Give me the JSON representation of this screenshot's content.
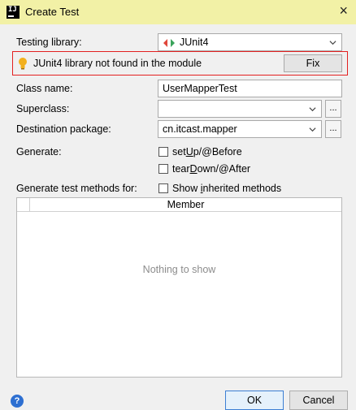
{
  "window": {
    "title": "Create Test",
    "close_glyph": "×",
    "app_icon_text": "IJ"
  },
  "testing_library": {
    "label": "Testing library:",
    "value": "JUnit4",
    "icon": "junit-arrows-icon"
  },
  "warning": {
    "text": "JUnit4 library not found in the module",
    "fix_label": "Fix",
    "border_color": "#e32020"
  },
  "class_name": {
    "label": "Class name:",
    "value": "UserMapperTest"
  },
  "superclass": {
    "label": "Superclass:",
    "value": "",
    "browse_label": "..."
  },
  "destination_package": {
    "label": "Destination package:",
    "value": "cn.itcast.mapper",
    "browse_label": "..."
  },
  "generate": {
    "label": "Generate:",
    "options": [
      {
        "pre": "set",
        "mnemonic": "U",
        "post": "p/@Before",
        "checked": false
      },
      {
        "pre": "tear",
        "mnemonic": "D",
        "post": "own/@After",
        "checked": false
      }
    ]
  },
  "methods": {
    "label": "Generate test methods for:",
    "show_inherited": {
      "pre": "Show ",
      "mnemonic": "i",
      "post": "nherited methods",
      "checked": false
    },
    "column_header": "Member",
    "empty_text": "Nothing to show"
  },
  "footer": {
    "help_glyph": "?",
    "ok_label": "OK",
    "cancel_label": "Cancel"
  }
}
